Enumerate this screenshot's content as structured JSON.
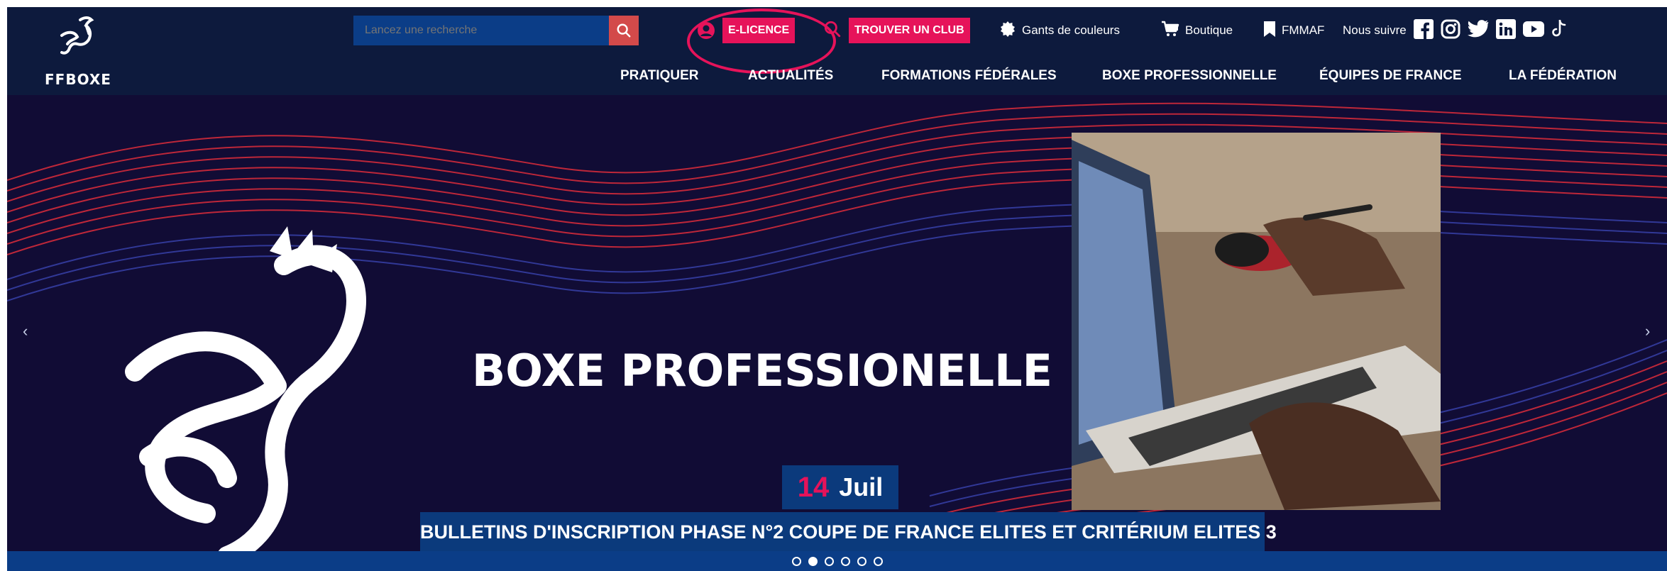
{
  "logo": {
    "text": "FFBOXE"
  },
  "search": {
    "placeholder": "Lancez une recherche"
  },
  "top_links": {
    "elicence": "E-LICENCE",
    "club": "TROUVER UN CLUB",
    "gants": "Gants de couleurs",
    "boutique": "Boutique",
    "fmmaf": "FMMAF",
    "follow": "Nous suivre"
  },
  "nav": {
    "items": [
      "PRATIQUER",
      "ACTUALITÉS",
      "FORMATIONS FÉDÉRALES",
      "BOXE PROFESSIONNELLE",
      "ÉQUIPES DE FRANCE",
      "LA FÉDÉRATION"
    ]
  },
  "hero": {
    "title": "BOXE PROFESSIONELLE",
    "date_day": "14",
    "date_month": "Juil",
    "caption": "BULLETINS D'INSCRIPTION PHASE N°2 COUPE DE FRANCE ELITES ET CRITÉRIUM ELITES 3",
    "slide_count": 6,
    "active_slide_index": 1
  },
  "icons": {
    "search": "search-icon",
    "user": "user-circle-icon",
    "club_search": "search-icon",
    "gants": "badge-icon",
    "cart": "cart-icon",
    "bookmark": "bookmark-icon",
    "facebook": "facebook-icon",
    "instagram": "instagram-icon",
    "twitter": "twitter-icon",
    "linkedin": "linkedin-icon",
    "youtube": "youtube-icon",
    "tiktok": "tiktok-icon"
  },
  "colors": {
    "header_bg": "#0d1a3d",
    "accent_pink": "#e6135a",
    "hero_bg": "#110c35",
    "caption_bg": "#0b3a7c"
  }
}
